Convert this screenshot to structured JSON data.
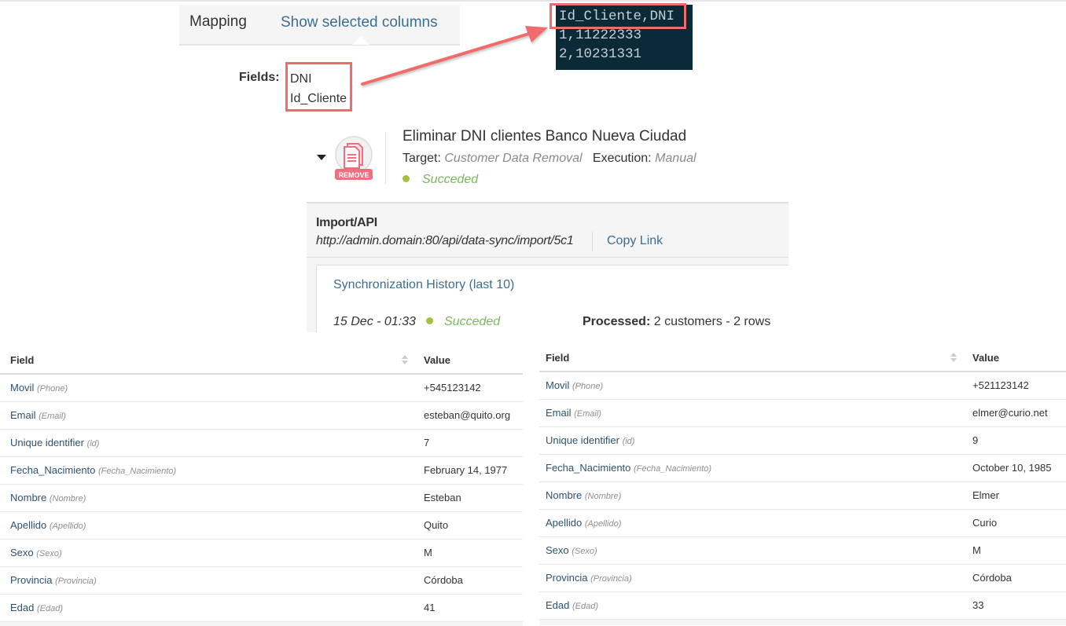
{
  "mapping_tabs": {
    "mapping_label": "Mapping",
    "show_columns_label": "Show selected columns"
  },
  "fields": {
    "label": "Fields:",
    "items": [
      "DNI",
      "Id_Cliente"
    ]
  },
  "csv_snippet": {
    "lines": [
      "Id_Cliente,DNI",
      "1,11222333",
      "2,10231331"
    ]
  },
  "job": {
    "icon": "remove-document-icon",
    "icon_badge": "REMOVE",
    "title": "Eliminar DNI clientes Banco Nueva Ciudad",
    "target_label": "Target:",
    "target_value": "Customer Data Removal",
    "execution_label": "Execution:",
    "execution_value": "Manual",
    "status": "Succeded",
    "status_color": "#a4c23b"
  },
  "import_api": {
    "title": "Import/API",
    "url": "http://admin.domain:80/api/data-sync/import/5c1",
    "copy_link_label": "Copy Link"
  },
  "sync_history": {
    "title": "Synchronization History (last 10)",
    "entries": [
      {
        "date": "15 Dec - 01:33",
        "status": "Succeded",
        "processed_label": "Processed:",
        "processed_value": "2 customers - 2 rows"
      }
    ]
  },
  "tables": [
    {
      "headers": {
        "field": "Field",
        "value": "Value"
      },
      "rows": [
        {
          "field": "Movil",
          "alias": "(Phone)",
          "value": "+545123142"
        },
        {
          "field": "Email",
          "alias": "(Email)",
          "value": "esteban@quito.org"
        },
        {
          "field": "Unique identifier",
          "alias": "(id)",
          "value": "7"
        },
        {
          "field": "Fecha_Nacimiento",
          "alias": "(Fecha_Nacimiento)",
          "value": "February 14, 1977"
        },
        {
          "field": "Nombre",
          "alias": "(Nombre)",
          "value": "Esteban"
        },
        {
          "field": "Apellido",
          "alias": "(Apellido)",
          "value": "Quito"
        },
        {
          "field": "Sexo",
          "alias": "(Sexo)",
          "value": "M"
        },
        {
          "field": "Provincia",
          "alias": "(Provincia)",
          "value": "Córdoba"
        },
        {
          "field": "Edad",
          "alias": "(Edad)",
          "value": "41"
        }
      ]
    },
    {
      "headers": {
        "field": "Field",
        "value": "Value"
      },
      "rows": [
        {
          "field": "Movil",
          "alias": "(Phone)",
          "value": "+521123142"
        },
        {
          "field": "Email",
          "alias": "(Email)",
          "value": "elmer@curio.net"
        },
        {
          "field": "Unique identifier",
          "alias": "(id)",
          "value": "9"
        },
        {
          "field": "Fecha_Nacimiento",
          "alias": "(Fecha_Nacimiento)",
          "value": "October 10, 1985"
        },
        {
          "field": "Nombre",
          "alias": "(Nombre)",
          "value": "Elmer"
        },
        {
          "field": "Apellido",
          "alias": "(Apellido)",
          "value": "Curio"
        },
        {
          "field": "Sexo",
          "alias": "(Sexo)",
          "value": "M"
        },
        {
          "field": "Provincia",
          "alias": "(Provincia)",
          "value": "Córdoba"
        },
        {
          "field": "Edad",
          "alias": "(Edad)",
          "value": "33"
        }
      ]
    }
  ],
  "colors": {
    "highlight": "#f06c6c",
    "link": "#3d6e8f",
    "success": "#7ab85d",
    "code_bg": "#0b2a38"
  }
}
